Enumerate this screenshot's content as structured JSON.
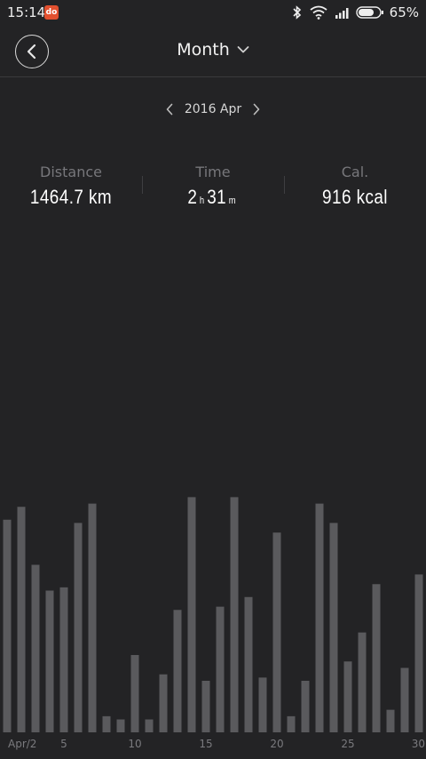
{
  "status_bar": {
    "time": "15:14",
    "app_badge": "do",
    "battery_percent": "65%",
    "icons": [
      "bluetooth-icon",
      "wifi-icon",
      "signal-icon",
      "battery-icon"
    ]
  },
  "header": {
    "back_icon": "chevron-left-icon",
    "period_label": "Month",
    "dropdown_icon": "chevron-down-icon"
  },
  "month_nav": {
    "label": "2016 Apr",
    "prev_icon": "chevron-left-icon",
    "next_icon": "chevron-right-icon"
  },
  "stats": {
    "distance": {
      "label": "Distance",
      "value": "1464.7 km"
    },
    "time": {
      "label": "Time",
      "hours": "2",
      "hours_unit": "h",
      "minutes": "31",
      "minutes_unit": "m"
    },
    "calories": {
      "label": "Cal.",
      "value": "916 kcal"
    }
  },
  "colors": {
    "background": "#232325",
    "bar": "#5a5a5d",
    "muted_text": "#77777b",
    "badge": "#e2502f"
  },
  "chart_data": {
    "type": "bar",
    "x": [
      1,
      2,
      3,
      4,
      5,
      6,
      7,
      8,
      9,
      10,
      11,
      12,
      13,
      14,
      15,
      16,
      17,
      18,
      19,
      20,
      21,
      22,
      23,
      24,
      25,
      26,
      27,
      28,
      29,
      30
    ],
    "values": [
      66,
      70,
      52,
      44,
      45,
      65,
      71,
      5,
      4,
      24,
      4,
      18,
      38,
      73,
      16,
      39,
      73,
      42,
      17,
      62,
      5,
      16,
      71,
      65,
      22,
      31,
      46,
      7,
      20,
      49
    ],
    "x_tick_labels": [
      {
        "day": 1,
        "label": "Apr/2"
      },
      {
        "day": 5,
        "label": "5"
      },
      {
        "day": 10,
        "label": "10"
      },
      {
        "day": 15,
        "label": "15"
      },
      {
        "day": 20,
        "label": "20"
      },
      {
        "day": 25,
        "label": "25"
      },
      {
        "day": 30,
        "label": "30"
      }
    ],
    "ylim": [
      0,
      80
    ],
    "grid": false
  }
}
